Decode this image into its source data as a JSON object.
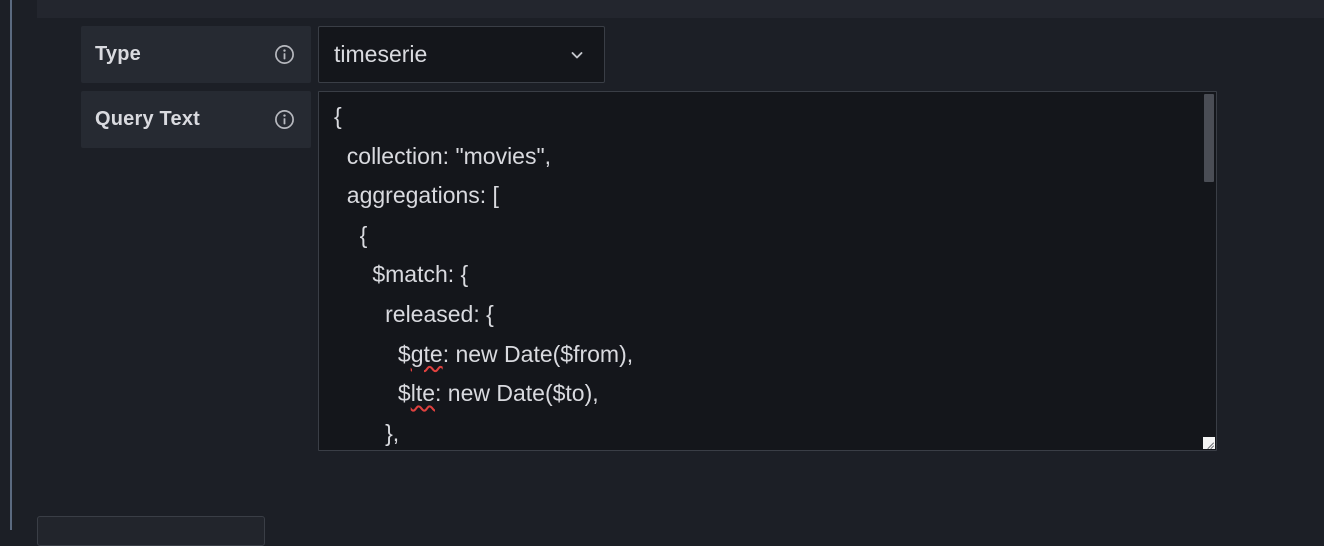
{
  "fields": {
    "type": {
      "label": "Type",
      "value": "timeserie"
    },
    "query_text": {
      "label": "Query Text",
      "lines": [
        {
          "indent": "",
          "pre": "{",
          "flag": "",
          "post": ""
        },
        {
          "indent": "  ",
          "pre": "collection: \"movies\",",
          "flag": "",
          "post": ""
        },
        {
          "indent": "  ",
          "pre": "aggregations: [",
          "flag": "",
          "post": ""
        },
        {
          "indent": "    ",
          "pre": "{",
          "flag": "",
          "post": ""
        },
        {
          "indent": "      ",
          "pre": "$match: {",
          "flag": "",
          "post": ""
        },
        {
          "indent": "        ",
          "pre": "released: {",
          "flag": "",
          "post": ""
        },
        {
          "indent": "          ",
          "pre": "$",
          "flag": "gte",
          "post": ": new Date($from),"
        },
        {
          "indent": "          ",
          "pre": "$",
          "flag": "lte",
          "post": ": new Date($to),"
        },
        {
          "indent": "        ",
          "pre": "},",
          "flag": "",
          "post": ""
        }
      ]
    }
  },
  "icons": {
    "info": "info-circle-icon",
    "chevron": "chevron-down-icon",
    "resize": "resize-grip-icon"
  },
  "colors": {
    "background": "#1c1f26",
    "label_bg": "#262a32",
    "input_bg": "#14161b",
    "border": "#3a3e46",
    "text": "#d9dadf",
    "spellcheck": "#e0413f"
  }
}
